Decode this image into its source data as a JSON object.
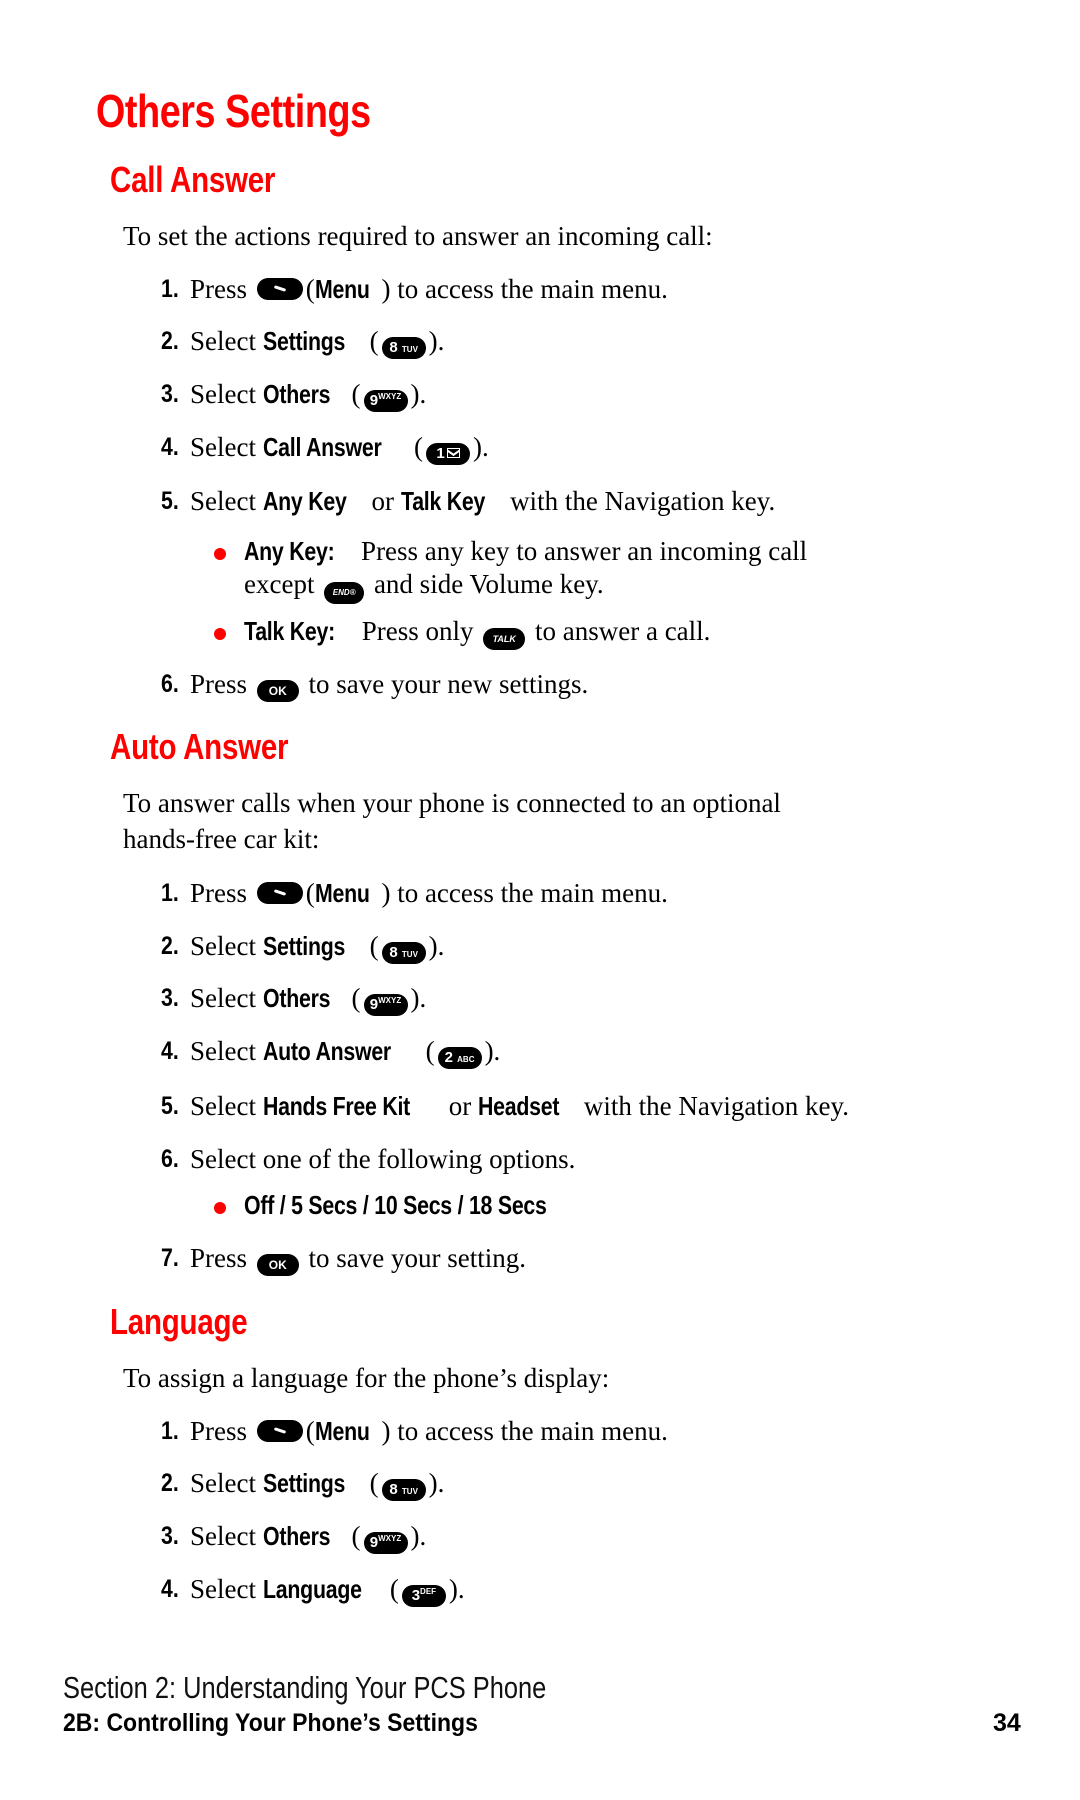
{
  "page": {
    "title": "Others Settings",
    "accent_color": "#ff0000"
  },
  "sections": {
    "call_answer": {
      "heading": "Call Answer",
      "intro": "To set the actions required to answer an incoming call:",
      "steps": [
        {
          "num": "1.",
          "pre": "Press",
          "key": "menu-softkey",
          "mid_open": "(",
          "bold": "Menu",
          "post": ") to access the main menu."
        },
        {
          "num": "2.",
          "pre": "Select",
          "bold": "Settings",
          "paren_open": "(",
          "key_label": "8",
          "key_sub": "TUV",
          "paren_close": ")."
        },
        {
          "num": "3.",
          "pre": "Select",
          "bold": "Others",
          "paren_open": "(",
          "key_label": "9",
          "key_sub": "WXYZ",
          "paren_close": ")."
        },
        {
          "num": "4.",
          "pre": "Select",
          "bold": "Call Answer",
          "paren_open": "(",
          "key_label": "1",
          "key_sub": "envelope",
          "paren_close": ")."
        },
        {
          "num": "5.",
          "pre": "Select",
          "bold": "Any Key",
          "mid": "or",
          "bold2": "Talk Key",
          "post": "with the Navigation key."
        },
        {
          "num": "6.",
          "pre": "Press",
          "key_label": "OK",
          "post": "to save your new settings."
        }
      ],
      "bullets": [
        {
          "bold": "Any Key:",
          "text": "Press any key to answer an incoming call",
          "text2_pre": "except",
          "key_label": "END",
          "text2_post": "and side Volume key."
        },
        {
          "bold": "Talk Key:",
          "text": "Press only",
          "key_label": "TALK",
          "text_post": "to answer a call."
        }
      ]
    },
    "auto_answer": {
      "heading": "Auto Answer",
      "intro_line1": "To answer calls when your phone is connected to an optional",
      "intro_line2": "hands-free car kit:",
      "steps": [
        {
          "num": "1.",
          "pre": "Press",
          "bold": "Menu",
          "mid_open": "(",
          "post": ") to access the main menu."
        },
        {
          "num": "2.",
          "pre": "Select",
          "bold": "Settings",
          "paren_open": "(",
          "key_label": "8",
          "key_sub": "TUV",
          "paren_close": ")."
        },
        {
          "num": "3.",
          "pre": "Select",
          "bold": "Others",
          "paren_open": "(",
          "key_label": "9",
          "key_sub": "WXYZ",
          "paren_close": ")."
        },
        {
          "num": "4.",
          "pre": "Select",
          "bold": "Auto Answer",
          "paren_open": "(",
          "key_label": "2",
          "key_sub": "ABC",
          "paren_close": ")."
        },
        {
          "num": "5.",
          "pre": "Select",
          "bold": "Hands Free Kit",
          "mid": "or",
          "bold2": "Headset",
          "post": "with the Navigation key."
        },
        {
          "num": "6.",
          "pre": "Select one of the following options."
        },
        {
          "num": "7.",
          "pre": "Press",
          "key_label": "OK",
          "post": "to save your setting."
        }
      ],
      "bullets": [
        {
          "bold": "Off / 5 Secs / 10 Secs / 18 Secs"
        }
      ]
    },
    "language": {
      "heading": "Language",
      "intro": "To assign a language for the phone’s display:",
      "steps": [
        {
          "num": "1.",
          "pre": "Press",
          "bold": "Menu",
          "mid_open": "(",
          "post": ") to access the main menu."
        },
        {
          "num": "2.",
          "pre": "Select",
          "bold": "Settings",
          "paren_open": "(",
          "key_label": "8",
          "key_sub": "TUV",
          "paren_close": ")."
        },
        {
          "num": "3.",
          "pre": "Select",
          "bold": "Others",
          "paren_open": "(",
          "key_label": "9",
          "key_sub": "WXYZ",
          "paren_close": ")."
        },
        {
          "num": "4.",
          "pre": "Select",
          "bold": "Language",
          "paren_open": "(",
          "key_label": "3",
          "key_sub": "DEF",
          "paren_close": ")."
        }
      ]
    }
  },
  "footer": {
    "section": "Section 2: Understanding Your PCS Phone",
    "chapter": "2B: Controlling Your Phone’s Settings",
    "page_number": "34"
  }
}
